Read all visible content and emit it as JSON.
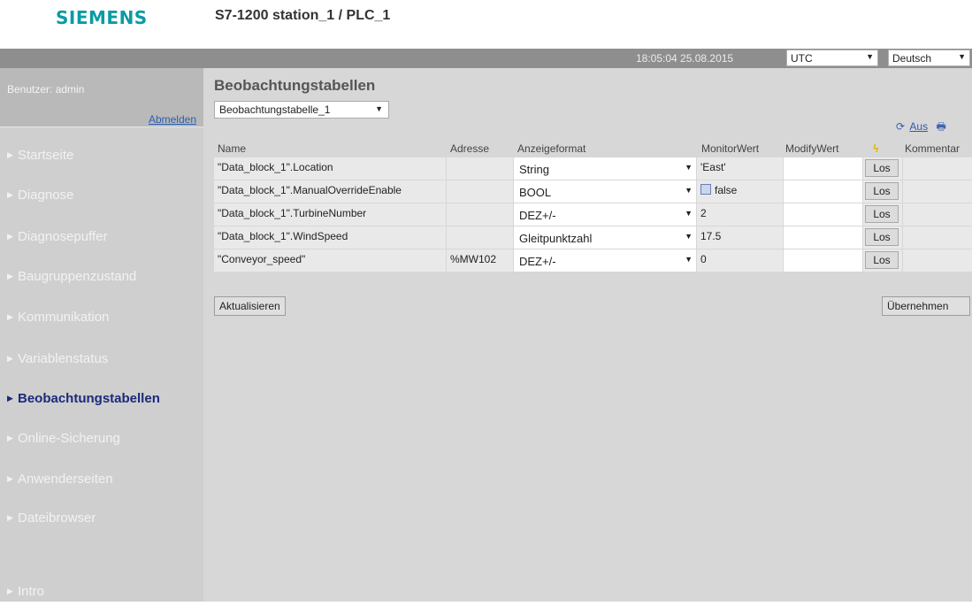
{
  "header": {
    "logo": "SIEMENS",
    "station_title": "S7-1200 station_1 / PLC_1",
    "datetime": "18:05:04  25.08.2015",
    "timezone": "UTC",
    "language": "Deutsch"
  },
  "sidebar": {
    "user_label": "Benutzer: admin",
    "logout": "Abmelden",
    "items": [
      {
        "label": "Startseite",
        "active": false
      },
      {
        "label": "Diagnose",
        "active": false
      },
      {
        "label": "Diagnosepuffer",
        "active": false
      },
      {
        "label": "Baugruppenzustand",
        "active": false
      },
      {
        "label": "Kommunikation",
        "active": false
      },
      {
        "label": "Variablenstatus",
        "active": false
      },
      {
        "label": "Beobachtungstabellen",
        "active": true
      },
      {
        "label": "Online-Sicherung",
        "active": false
      },
      {
        "label": "Anwenderseiten",
        "active": false
      },
      {
        "label": "Dateibrowser",
        "active": false
      },
      {
        "label": "Intro",
        "active": false
      }
    ]
  },
  "main": {
    "title": "Beobachtungstabellen",
    "table_select": "Beobachtungstabelle_1",
    "refresh_label": "Aus",
    "columns": {
      "name": "Name",
      "address": "Adresse",
      "format": "Anzeigeformat",
      "monitor": "MonitorWert",
      "modify": "ModifyWert",
      "trigger_icon": "lightning-icon",
      "comment": "Kommentar"
    },
    "rows": [
      {
        "name": "\"Data_block_1\".Location",
        "address": "",
        "format": "String",
        "monitor": "'East'",
        "modify": "",
        "button": "Los"
      },
      {
        "name": "\"Data_block_1\".ManualOverrideEnable",
        "address": "",
        "format": "BOOL",
        "monitor": "false",
        "monitor_checkbox": true,
        "modify": "",
        "button": "Los"
      },
      {
        "name": "\"Data_block_1\".TurbineNumber",
        "address": "",
        "format": "DEZ+/-",
        "monitor": "2",
        "modify": "",
        "button": "Los"
      },
      {
        "name": "\"Data_block_1\".WindSpeed",
        "address": "",
        "format": "Gleitpunktzahl",
        "monitor": "17.5",
        "modify": "",
        "button": "Los"
      },
      {
        "name": "\"Conveyor_speed\"",
        "address": "%MW102",
        "format": "DEZ+/-",
        "monitor": "0",
        "modify": "",
        "button": "Los"
      }
    ],
    "update_button": "Aktualisieren",
    "apply_button": "Übernehmen"
  },
  "colors": {
    "brand": "#0b9ba4",
    "active_nav": "#1a2a7a",
    "link": "#2a5db0"
  }
}
